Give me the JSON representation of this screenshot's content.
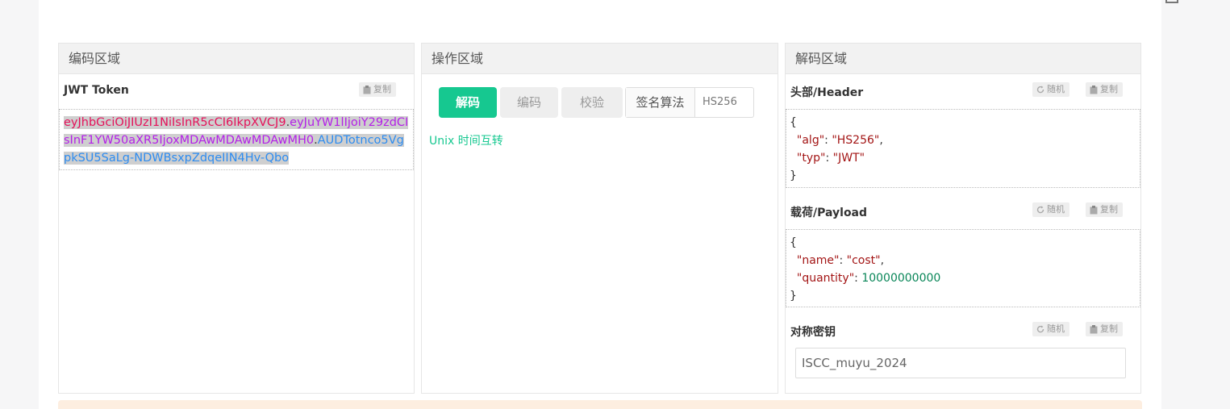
{
  "encode_panel": {
    "title": "编码区域",
    "subtitle": "JWT Token",
    "copy_label": "复制",
    "token": {
      "header": "eyJhbGciOiJIUzI1NiIsInR5cCI6IkpXVCJ9",
      "dot1": ".",
      "payload": "eyJuYW1lIjoiY29zdCIsInF1YW50aXR5IjoxMDAwMDAwMDAwMH0",
      "dot2": ".",
      "signature": "AUDTotnco5VgpkSU5SaLg-NDWBsxpZdqeIIN4Hv-Qbo"
    }
  },
  "operation_panel": {
    "title": "操作区域",
    "decode_button": "解码",
    "encode_button": "编码",
    "verify_button": "校验",
    "algorithm_label": "签名算法",
    "algorithm_value": "HS256",
    "unix_link": "Unix 时间互转"
  },
  "decode_panel": {
    "title": "解码区域",
    "random_label": "随机",
    "copy_label": "复制",
    "header": {
      "title": "头部/Header",
      "open": "{",
      "line1_key": "\"alg\"",
      "line1_sep": ": ",
      "line1_val": "\"HS256\"",
      "line1_end": ",",
      "line2_key": "\"typ\"",
      "line2_sep": ": ",
      "line2_val": "\"JWT\"",
      "close": "}"
    },
    "payload": {
      "title": "载荷/Payload",
      "open": "{",
      "line1_key": "\"name\"",
      "line1_sep": ": ",
      "line1_val": "\"cost\"",
      "line1_end": ",",
      "line2_key": "\"quantity\"",
      "line2_sep": ": ",
      "line2_val": "10000000000",
      "close": "}"
    },
    "secret": {
      "title": "对称密钥",
      "value": "ISCC_muyu_2024"
    }
  }
}
